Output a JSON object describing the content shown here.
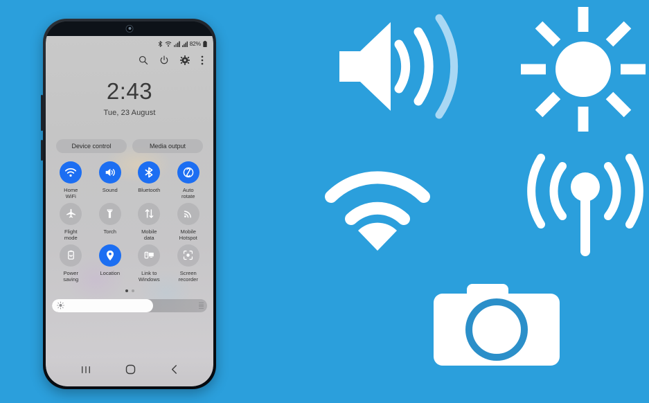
{
  "background_color": "#2b9fdc",
  "phone": {
    "status_bar": {
      "icons": [
        "bluetooth-icon",
        "wifi-status-icon",
        "signal-bars-icon",
        "mobile-signal-icon"
      ],
      "battery_percent": "82%",
      "battery_icon": "battery-icon"
    },
    "toolbar": {
      "items": [
        {
          "name": "search-icon",
          "label": "Search"
        },
        {
          "name": "power-icon",
          "label": "Power"
        },
        {
          "name": "settings-gear-icon",
          "label": "Settings"
        },
        {
          "name": "more-options-icon",
          "label": "More options"
        }
      ]
    },
    "clock": {
      "time": "2:43",
      "date": "Tue, 23 August"
    },
    "pills": [
      {
        "label": "Device control",
        "name": "device-control-button"
      },
      {
        "label": "Media output",
        "name": "media-output-button"
      }
    ],
    "tiles": [
      {
        "label": "Home\nWiFi",
        "name": "tile-home-wifi",
        "icon": "wifi-icon",
        "active": true
      },
      {
        "label": "Sound",
        "name": "tile-sound",
        "icon": "speaker-icon",
        "active": true
      },
      {
        "label": "Bluetooth",
        "name": "tile-bluetooth",
        "icon": "bluetooth-icon",
        "active": true
      },
      {
        "label": "Auto\nrotate",
        "name": "tile-auto-rotate",
        "icon": "auto-rotate-icon",
        "active": true
      },
      {
        "label": "Flight\nmode",
        "name": "tile-flight-mode",
        "icon": "airplane-icon",
        "active": false
      },
      {
        "label": "Torch",
        "name": "tile-torch",
        "icon": "flashlight-icon",
        "active": false
      },
      {
        "label": "Mobile\ndata",
        "name": "tile-mobile-data",
        "icon": "data-arrows-icon",
        "active": false
      },
      {
        "label": "Mobile\nHotspot",
        "name": "tile-mobile-hotspot",
        "icon": "hotspot-icon",
        "active": false
      },
      {
        "label": "Power\nsaving",
        "name": "tile-power-saving",
        "icon": "battery-leaf-icon",
        "active": false
      },
      {
        "label": "Location",
        "name": "tile-location",
        "icon": "location-pin-icon",
        "active": true
      },
      {
        "label": "Link to\nWindows",
        "name": "tile-link-to-windows",
        "icon": "windows-link-icon",
        "active": false
      },
      {
        "label": "Screen\nrecorder",
        "name": "tile-screen-recorder",
        "icon": "screen-record-icon",
        "active": false
      }
    ],
    "page_dots": {
      "count": 2,
      "active_index": 0
    },
    "brightness": {
      "name": "brightness-slider",
      "icon": "brightness-sun-icon",
      "value_percent": 65
    },
    "nav_bar": [
      {
        "name": "recents-button",
        "icon": "recents-icon"
      },
      {
        "name": "home-button",
        "icon": "home-circle-icon"
      },
      {
        "name": "back-button",
        "icon": "back-chevron-icon"
      }
    ]
  },
  "decorative_icons": [
    {
      "name": "volume-icon",
      "label": "Volume",
      "color": "#ffffff"
    },
    {
      "name": "sun-icon",
      "label": "Brightness",
      "color": "#ffffff"
    },
    {
      "name": "wifi-icon",
      "label": "Wi-Fi",
      "color": "#ffffff"
    },
    {
      "name": "hotspot-icon",
      "label": "Hotspot",
      "color": "#ffffff"
    },
    {
      "name": "camera-icon",
      "label": "Camera",
      "color": "#ffffff",
      "accent": "#2b8fc9"
    }
  ]
}
